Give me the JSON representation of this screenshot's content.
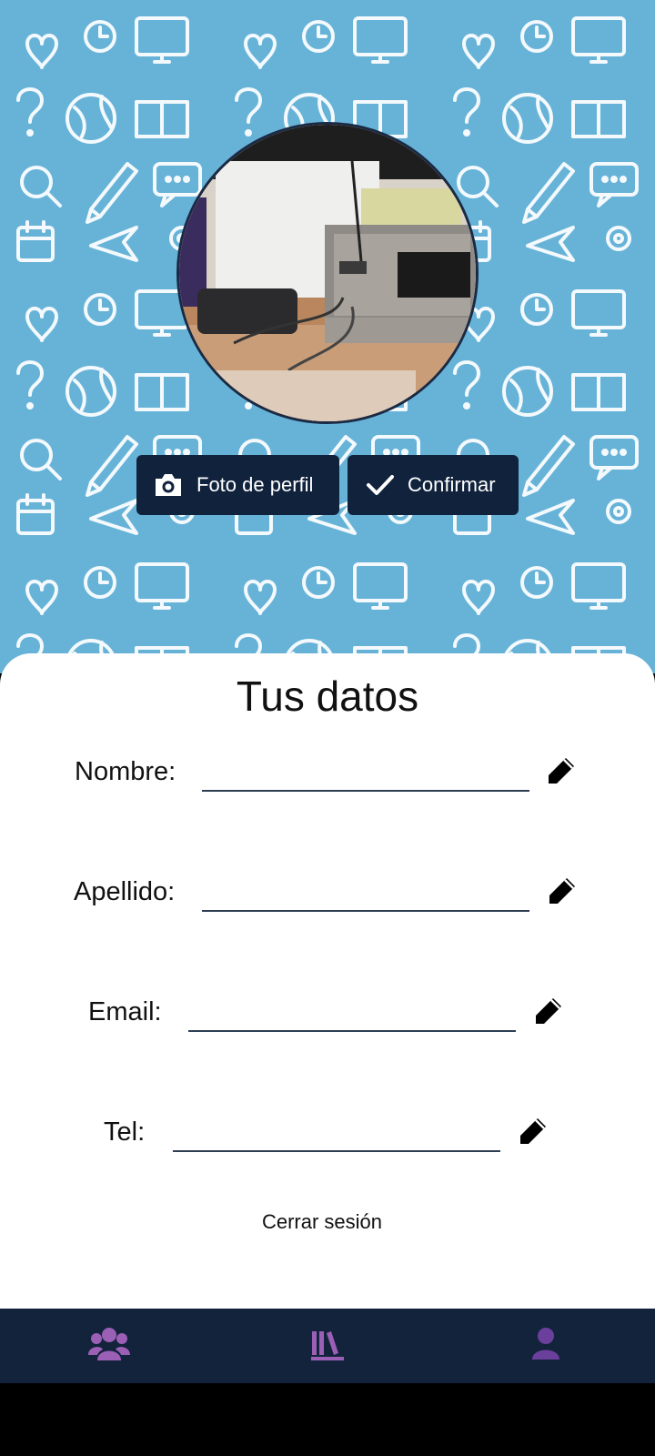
{
  "profile": {
    "photo_button_label": "Foto de perfil",
    "confirm_button_label": "Confirmar"
  },
  "form": {
    "title": "Tus datos",
    "fields": [
      {
        "label": "Nombre:",
        "value": ""
      },
      {
        "label": "Apellido:",
        "value": ""
      },
      {
        "label": "Email:",
        "value": ""
      },
      {
        "label": "Tel:",
        "value": ""
      }
    ],
    "logout_label": "Cerrar sesión"
  },
  "bottom_nav": {
    "items": [
      {
        "icon": "users-icon",
        "active": false
      },
      {
        "icon": "library-icon",
        "active": true
      },
      {
        "icon": "user-icon",
        "active": false
      }
    ]
  },
  "colors": {
    "hero_background": "#67b3d8",
    "button_background": "#11223d",
    "navbar_background": "#13233c",
    "nav_icon": "#9b5fb6"
  }
}
